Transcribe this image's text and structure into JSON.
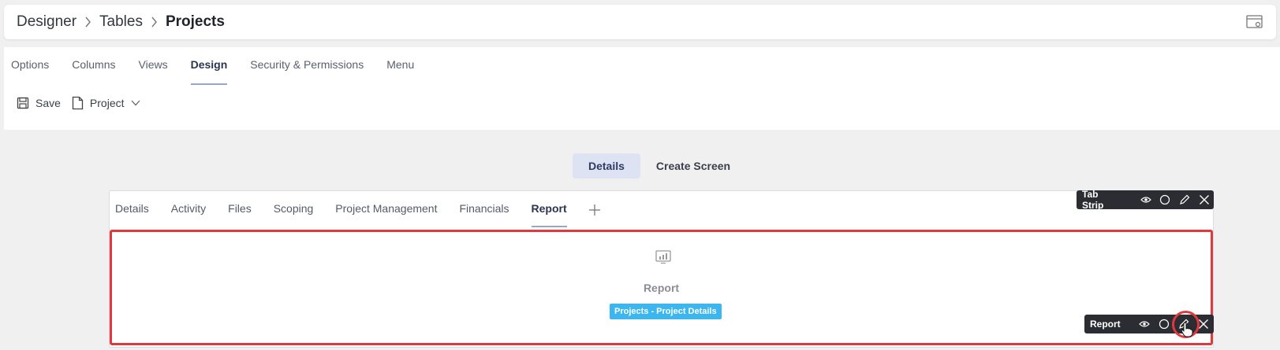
{
  "breadcrumb": {
    "items": [
      "Designer",
      "Tables"
    ],
    "current": "Projects"
  },
  "tabs": [
    "Options",
    "Columns",
    "Views",
    "Design",
    "Security & Permissions",
    "Menu"
  ],
  "active_tab": "Design",
  "toolbar": {
    "save_label": "Save",
    "entity_label": "Project"
  },
  "segment": {
    "details_label": "Details",
    "create_label": "Create Screen"
  },
  "designer_tabs": [
    "Details",
    "Activity",
    "Files",
    "Scoping",
    "Project Management",
    "Financials",
    "Report"
  ],
  "designer_active_tab": "Report",
  "tab_strip_toolbar": {
    "label": "Tab Strip"
  },
  "report": {
    "label": "Report",
    "badge": "Projects - Project Details"
  },
  "report_toolbar": {
    "label": "Report"
  },
  "icons": [
    "save-icon",
    "document-icon",
    "chevron-down-icon",
    "chevron-right-icon",
    "view-panel-icon",
    "plus-icon",
    "eye-icon",
    "circle-icon",
    "pencil-icon",
    "close-icon",
    "report-chart-icon",
    "hand-cursor-icon"
  ],
  "colors": {
    "accent": "#2f3c62",
    "highlight": "#e0393d",
    "badge": "#3cb6ee",
    "toolbar_bg": "#2b2d33"
  }
}
